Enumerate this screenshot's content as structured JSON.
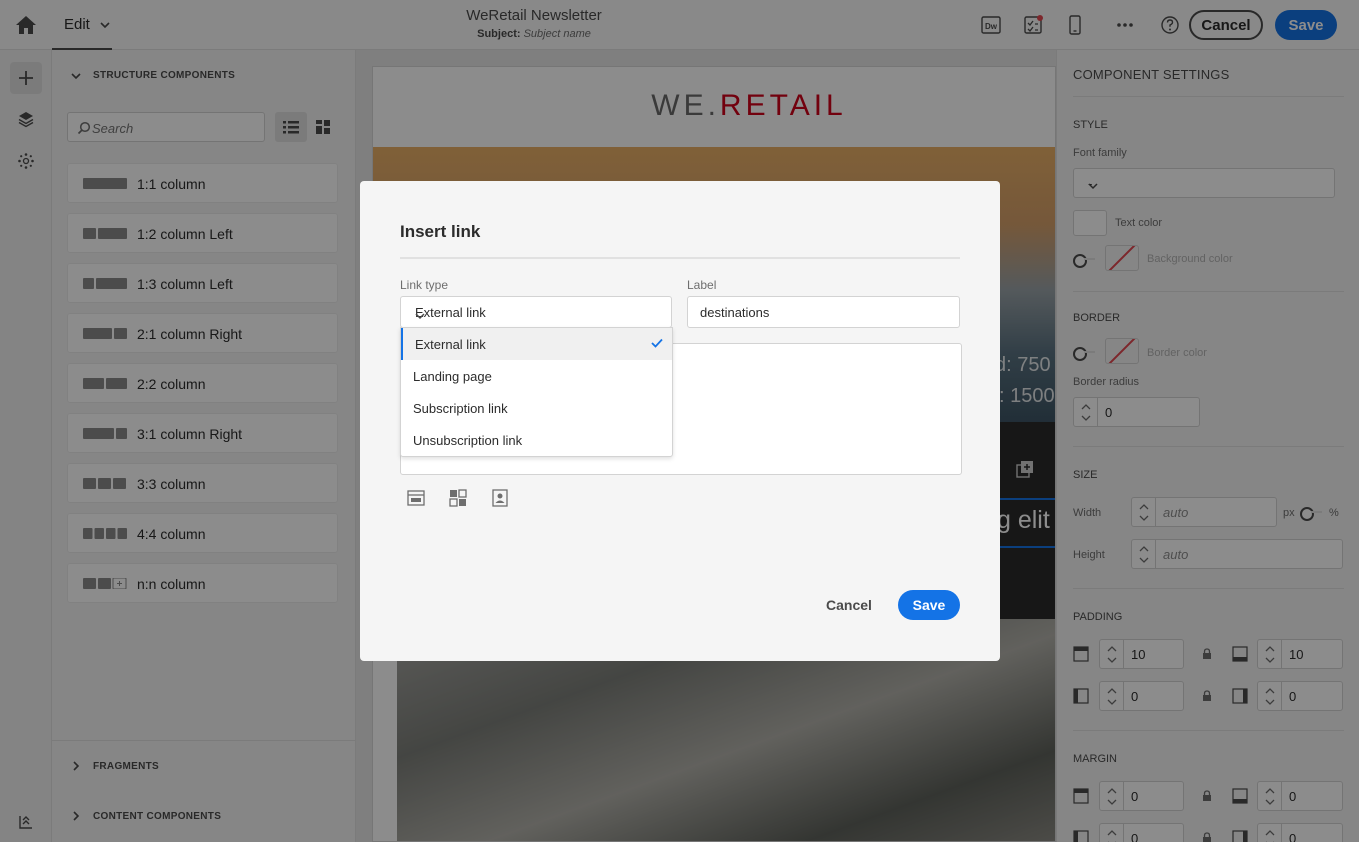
{
  "header": {
    "edit_label": "Edit",
    "document_title": "WeRetail Newsletter",
    "subject_label": "Subject:",
    "subject_value": "Subject name",
    "dw_icon_text": "Dw",
    "cancel_label": "Cancel",
    "save_label": "Save",
    "icons": [
      "home-icon",
      "chevron-down-icon",
      "dw-icon",
      "checklist-icon",
      "mobile-preview-icon",
      "more-icon",
      "help-icon"
    ],
    "accent_color": "#1473e6",
    "notification_color": "#e34850"
  },
  "rail": {
    "icons": [
      "add-icon",
      "layers-icon",
      "personalization-icon",
      "bottom-settings-icon"
    ]
  },
  "left_panel": {
    "structure_title": "STRUCTURE COMPONENTS",
    "search_placeholder": "Search",
    "components": [
      {
        "label": "1:1 column"
      },
      {
        "label": "1:2 column Left"
      },
      {
        "label": "1:3 column Left"
      },
      {
        "label": "2:1 column Right"
      },
      {
        "label": "2:2 column"
      },
      {
        "label": "3:1 column Right"
      },
      {
        "label": "3:3 column"
      },
      {
        "label": "4:4 column"
      },
      {
        "label": "n:n column"
      }
    ],
    "fragments_title": "FRAGMENTS",
    "content_title": "CONTENT COMPONENTS"
  },
  "canvas": {
    "logo_prefix": "WE.",
    "logo_brand": "RETAIL",
    "logo_brand_color": "#d0021b",
    "hero_text_1": "d: 750",
    "hero_text_2": ": 1500",
    "hero_text_3": "g elit"
  },
  "right_panel": {
    "title": "COMPONENT SETTINGS",
    "style_title": "STYLE",
    "font_family_label": "Font family",
    "font_family_value": "-",
    "text_color_label": "Text color",
    "background_color_label": "Background color",
    "border_title": "BORDER",
    "border_color_label": "Border color",
    "border_radius_label": "Border radius",
    "border_radius_value": "0",
    "size_title": "SIZE",
    "width_label": "Width",
    "width_placeholder": "auto",
    "unit_px": "px",
    "unit_pct": "%",
    "height_label": "Height",
    "height_placeholder": "auto",
    "padding_title": "PADDING",
    "padding": {
      "top": "10",
      "bottom": "10",
      "left": "0",
      "right": "0"
    },
    "margin_title": "MARGIN",
    "margin": {
      "top": "0",
      "bottom": "0",
      "left": "0",
      "right": "0"
    }
  },
  "modal": {
    "title": "Insert link",
    "link_type_label": "Link type",
    "link_type_value": "External link",
    "label_label": "Label",
    "label_value": "destinations",
    "options": [
      {
        "label": "External link",
        "selected": true
      },
      {
        "label": "Landing page",
        "selected": false
      },
      {
        "label": "Subscription link",
        "selected": false
      },
      {
        "label": "Unsubscription link",
        "selected": false
      }
    ],
    "tool_icons": [
      "insert-block-icon",
      "insert-grid-icon",
      "insert-personalization-icon"
    ],
    "cancel_label": "Cancel",
    "save_label": "Save"
  }
}
